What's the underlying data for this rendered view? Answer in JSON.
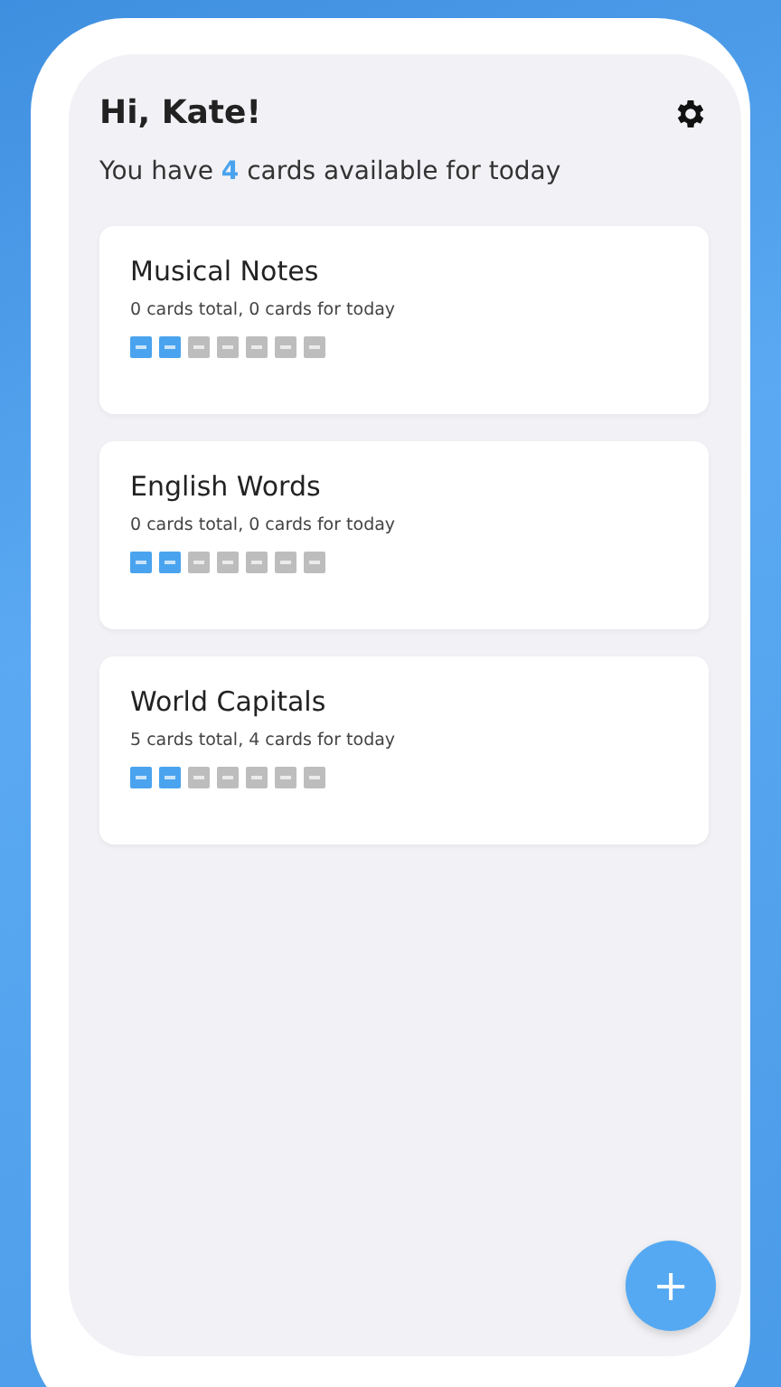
{
  "greeting": "Hi, Kate!",
  "subtitle": {
    "before": "You have",
    "count": "4",
    "after": "cards available for today"
  },
  "decks": [
    {
      "title": "Musical Notes",
      "stats": "0 cards total, 0 cards for today",
      "boxes": [
        {
          "filled": true
        },
        {
          "filled": true
        },
        {
          "filled": false
        },
        {
          "filled": false
        },
        {
          "filled": false
        },
        {
          "filled": false
        },
        {
          "filled": false
        }
      ]
    },
    {
      "title": "English Words",
      "stats": "0 cards total, 0 cards for today",
      "boxes": [
        {
          "filled": true
        },
        {
          "filled": true
        },
        {
          "filled": false
        },
        {
          "filled": false
        },
        {
          "filled": false
        },
        {
          "filled": false
        },
        {
          "filled": false
        }
      ]
    },
    {
      "title": "World Capitals",
      "stats": "5 cards total, 4 cards for today",
      "boxes": [
        {
          "filled": true
        },
        {
          "filled": true
        },
        {
          "filled": false
        },
        {
          "filled": false
        },
        {
          "filled": false
        },
        {
          "filled": false
        },
        {
          "filled": false
        }
      ]
    }
  ],
  "fab": "+"
}
